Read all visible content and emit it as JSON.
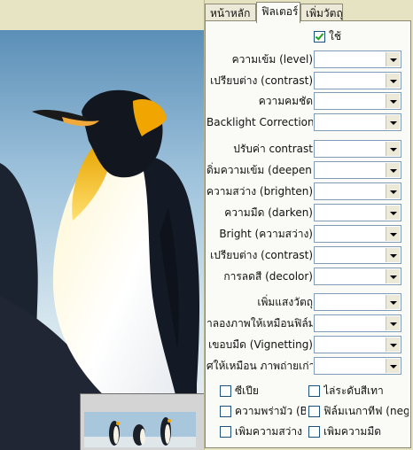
{
  "tabs": [
    "หน้าหลัก",
    "ฟิลเตอร์",
    "เพิ่มวัตถุ"
  ],
  "enable": {
    "label": "ใช้",
    "checked": true
  },
  "filters_group1": [
    "ความเข้ม (level)",
    "เปรียบต่าง (contrast)",
    "ความคมชัด",
    "Backlight Correction"
  ],
  "filters_group2": [
    "ปรับค่า contrast",
    "ดิ่มความเข้ม (deepen)",
    "ความสว่าง (brighten)",
    "ความมืด (darken)",
    "Bright (ความสว่าง)",
    "เปรียบต่าง (contrast)",
    "การลดสี (decolor)"
  ],
  "filters_group3": [
    "เพิ่มแสงวัตถุ",
    "าลองภาพให้เหมือนฟิล์ม",
    "เขอบมืด (Vignetting)",
    "ศให้เหมือน ภาพถ่ายเก่า"
  ],
  "checkboxes": [
    {
      "label": "ซีเปีย",
      "checked": false
    },
    {
      "label": "ไล่ระดับสีเทา",
      "checked": false
    },
    {
      "label": "ความพร่ามัว (Blu",
      "checked": false
    },
    {
      "label": "ฟิล์มเนกาทีฟ (neg",
      "checked": false
    },
    {
      "label": "เพิ่มความสว่าง",
      "checked": false
    },
    {
      "label": "เพิ่มความมืด",
      "checked": false
    }
  ]
}
